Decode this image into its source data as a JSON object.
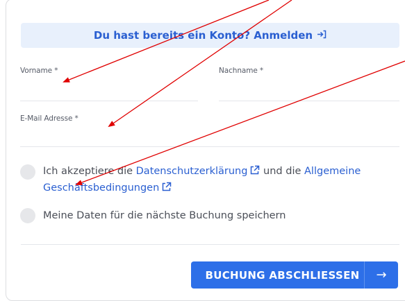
{
  "login_banner": {
    "text": "Du hast bereits ein Konto? Anmelden",
    "arrow_icon": "login-arrow-icon"
  },
  "form": {
    "firstname_label": "Vorname *",
    "lastname_label": "Nachname *",
    "email_label": "E-Mail Adresse *",
    "firstname_value": "",
    "lastname_value": "",
    "email_value": ""
  },
  "consent": {
    "prefix": "Ich akzeptiere die",
    "privacy_link": "Datenschutzerklärung",
    "middle": "und die",
    "terms_link": "Allgemeine Geschäftsbedingungen"
  },
  "save_data": {
    "label": "Meine Daten für die nächste Buchung speichern"
  },
  "submit": {
    "label": "BUCHUNG ABSCHLIESSEN",
    "arrow": "→"
  },
  "colors": {
    "accent": "#2d6fe8",
    "link": "#2a5fd1",
    "banner_bg": "#e8f0fc",
    "annotation_arrow": "#e00000"
  }
}
